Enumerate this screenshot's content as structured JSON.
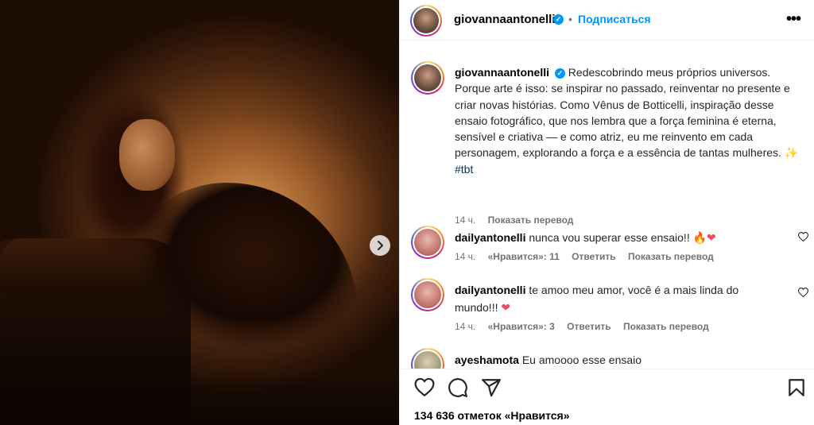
{
  "post": {
    "username": "giovannaantonelli",
    "follow_label": "Подписаться",
    "separator": "•",
    "verified_mark": "✓"
  },
  "caption": {
    "username": "giovannaantonelli",
    "text": "Redescobrindo meus próprios universos. Porque arte é isso: se inspirar no passado, reinventar no presente e criar novas histórias. Como Vênus de Botticelli, inspiração desse ensaio fotográfico, que nos lembra que a força feminina é eterna, sensível e criativa — e como atriz, eu me reinvento em cada personagem, explorando a força e a essência de tantas mulheres.",
    "emoji": "✨",
    "hashtag": "#tbt",
    "time": "14 ч.",
    "translate_label": "Показать перевод"
  },
  "comments": [
    {
      "username": "dailyantonelli",
      "text": "nunca vou superar esse ensaio!!",
      "emoji": "🔥❤",
      "time": "14 ч.",
      "likes_label": "«Нравится»: 11",
      "reply_label": "Ответить",
      "translate_label": "Показать перевод"
    },
    {
      "username": "dailyantonelli",
      "text": "te amoo meu amor, você é a mais linda do mundo!!!",
      "emoji": "❤",
      "time": "14 ч.",
      "likes_label": "«Нравится»: 3",
      "reply_label": "Ответить",
      "translate_label": "Показать перевод"
    },
    {
      "username": "ayeshamota",
      "text": "Eu amoooo esse ensaio"
    }
  ],
  "likes_text": "134 636 отметок «Нравится»",
  "icons": {
    "more": "more-options-icon",
    "carousel_next": "chevron-right-icon",
    "like": "heart-icon",
    "comment": "comment-icon",
    "share": "share-icon",
    "save": "bookmark-icon"
  },
  "colors": {
    "accent": "#0095f6",
    "heart": "#ed4956",
    "hashtag": "#00376b",
    "muted": "#737373"
  }
}
